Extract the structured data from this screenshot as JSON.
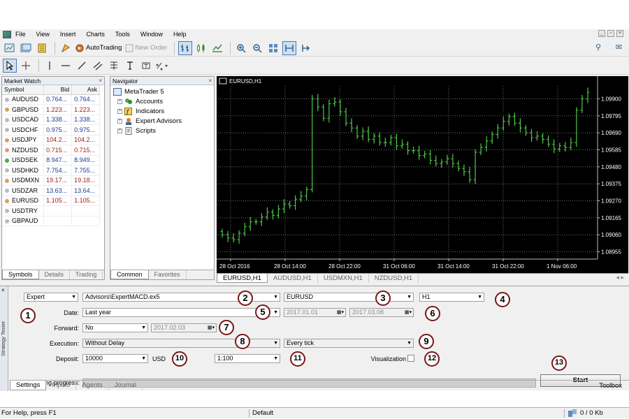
{
  "menu": [
    "File",
    "View",
    "Insert",
    "Charts",
    "Tools",
    "Window",
    "Help"
  ],
  "toolbar": {
    "autotrading": "AutoTrading",
    "new_order": "New Order"
  },
  "market_watch": {
    "title": "Market Watch",
    "columns": [
      "Symbol",
      "Bid",
      "Ask"
    ],
    "rows": [
      {
        "symbol": "AUDUSD",
        "bid": "0.764...",
        "ask": "0.764...",
        "color": "blue"
      },
      {
        "symbol": "GBPUSD",
        "bid": "1.223...",
        "ask": "1.223...",
        "color": "red"
      },
      {
        "symbol": "USDCAD",
        "bid": "1.338...",
        "ask": "1.338...",
        "color": "blue"
      },
      {
        "symbol": "USDCHF",
        "bid": "0.975...",
        "ask": "0.975...",
        "color": "blue"
      },
      {
        "symbol": "USDJPY",
        "bid": "104.2...",
        "ask": "104.2...",
        "color": "red"
      },
      {
        "symbol": "NZDUSD",
        "bid": "0.715...",
        "ask": "0.715...",
        "color": "red"
      },
      {
        "symbol": "USDSEK",
        "bid": "8.947...",
        "ask": "8.949...",
        "color": "blue"
      },
      {
        "symbol": "USDHKD",
        "bid": "7.754...",
        "ask": "7.755...",
        "color": "blue"
      },
      {
        "symbol": "USDMXN",
        "bid": "19.17...",
        "ask": "19.18...",
        "color": "red"
      },
      {
        "symbol": "USDZAR",
        "bid": "13.63...",
        "ask": "13.64...",
        "color": "blue"
      },
      {
        "symbol": "EURUSD",
        "bid": "1.105...",
        "ask": "1.105...",
        "color": "red"
      },
      {
        "symbol": "USDTRY",
        "bid": "",
        "ask": "",
        "color": "blue"
      },
      {
        "symbol": "GBPAUD",
        "bid": "",
        "ask": "",
        "color": "blue"
      }
    ],
    "tabs": [
      "Symbols",
      "Details",
      "Trading"
    ]
  },
  "navigator": {
    "title": "Navigator",
    "root": "MetaTrader 5",
    "items": [
      "Accounts",
      "Indicators",
      "Expert Advisors",
      "Scripts"
    ],
    "tabs": [
      "Common",
      "Favorites"
    ]
  },
  "chart": {
    "label": "EURUSD,H1",
    "tabs": [
      "EURUSD,H1",
      "AUDUSD,H1",
      "USDMXN,H1",
      "NZDUSD,H1"
    ],
    "colors": {
      "background": "#000000",
      "grid": "#6c6c6c",
      "candle": "#4fc84a"
    }
  },
  "chart_data": {
    "type": "bar",
    "title": "EURUSD,H1",
    "x_ticks": [
      "28 Oct 2016",
      "28 Oct 14:00",
      "28 Oct 22:00",
      "31 Oct 06:00",
      "31 Oct 14:00",
      "31 Oct 22:00",
      "1 Nov 06:00"
    ],
    "y_ticks": [
      "1.09900",
      "1.09795",
      "1.09690",
      "1.09585",
      "1.09480",
      "1.09375",
      "1.09270",
      "1.09165",
      "1.09060",
      "1.08955"
    ],
    "ylim": [
      1.0891,
      1.0998
    ],
    "close": [
      1.0906,
      1.0904,
      1.0903,
      1.0907,
      1.0911,
      1.0914,
      1.0914,
      1.0917,
      1.092,
      1.0918,
      1.0922,
      1.0925,
      1.0924,
      1.0928,
      1.093,
      1.0934,
      1.099,
      1.0985,
      1.0978,
      1.0987,
      1.0988,
      1.0982,
      1.0975,
      1.0972,
      1.0967,
      1.097,
      1.0965,
      1.0967,
      1.0963,
      1.0963,
      1.0966,
      1.0961,
      1.0962,
      1.0958,
      1.0958,
      1.0955,
      1.0956,
      1.0952,
      1.095,
      1.0951,
      1.0953,
      1.095,
      1.0947,
      1.0945,
      1.094,
      1.0957,
      1.096,
      1.0964,
      1.0968,
      1.0972,
      1.0976,
      1.0979,
      1.0975,
      1.0972,
      1.0969,
      1.0966,
      1.0967,
      1.0965,
      1.0962,
      1.0959,
      1.0961,
      1.096,
      1.0963,
      1.0983,
      1.099,
      1.0994
    ]
  },
  "tester": {
    "side_label": "Strategy Tester",
    "mode": "Expert",
    "expert": "Advisors\\ExpertMACD.ex5",
    "symbol": "EURUSD",
    "period": "H1",
    "date_label": "Date:",
    "date": "Last year",
    "from": "2017.01.01",
    "to": "2017.03.08",
    "forward_label": "Forward:",
    "forward": "No",
    "forward_date": "2017.02.03",
    "execution_label": "Execution:",
    "execution": "Without Delay",
    "ticks": "Every tick",
    "deposit_label": "Deposit:",
    "deposit": "10000",
    "currency": "USD",
    "leverage": "1:100",
    "visualization": "Visualization",
    "progress_label": "Testing progress:",
    "start": "Start",
    "tabs": [
      "Settings",
      "Inputs",
      "Agents",
      "Journal"
    ],
    "toolbox": "Toolbox",
    "markers": [
      "1",
      "2",
      "3",
      "4",
      "5",
      "6",
      "7",
      "8",
      "9",
      "10",
      "11",
      "12",
      "13"
    ]
  },
  "status": {
    "help": "For Help, press F1",
    "profile": "Default",
    "traffic": "0 / 0 Kb"
  }
}
